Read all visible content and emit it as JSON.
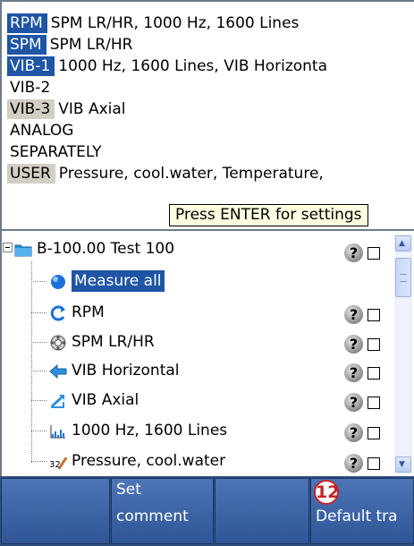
{
  "technologies": [
    {
      "tag": "RPM",
      "desc": "SPM LR/HR, 1000 Hz, 1600 Lines",
      "style": "sel"
    },
    {
      "tag": "SPM",
      "desc": "SPM LR/HR",
      "style": "sel"
    },
    {
      "tag": "VIB-1",
      "desc": "1000 Hz, 1600 Lines, VIB Horizonta",
      "style": "sel"
    },
    {
      "tag": "VIB-2",
      "desc": "",
      "style": "plain"
    },
    {
      "tag": "VIB-3",
      "desc": "VIB Axial",
      "style": "gray"
    },
    {
      "tag": "ANALOG",
      "desc": "",
      "style": "plain"
    },
    {
      "tag": "SEPARATELY",
      "desc": "",
      "style": "plain"
    },
    {
      "tag": "USER",
      "desc": "Pressure, cool.water, Temperature,",
      "style": "gray"
    }
  ],
  "tooltip": "Press ENTER for settings",
  "tree": {
    "root": {
      "label": "B-100.00 Test 100",
      "status": "?"
    },
    "children": [
      {
        "label": "Measure all",
        "icon": "measure-all-icon",
        "selected": true
      },
      {
        "label": "RPM",
        "icon": "rpm-icon",
        "status": "?"
      },
      {
        "label": "SPM LR/HR",
        "icon": "spm-icon",
        "status": "?"
      },
      {
        "label": "VIB Horizontal",
        "icon": "vib-horizontal-icon",
        "status": "?"
      },
      {
        "label": "VIB Axial",
        "icon": "vib-axial-icon",
        "status": "?"
      },
      {
        "label": "1000 Hz, 1600 Lines",
        "icon": "spectrum-icon",
        "status": "?"
      },
      {
        "label": "Pressure, cool.water",
        "icon": "pressure-icon",
        "status": "?",
        "icon_text": "32"
      }
    ]
  },
  "function_bar": {
    "buttons": [
      {
        "line1": "",
        "line2": ""
      },
      {
        "line1": "Set",
        "line2": "comment"
      },
      {
        "line1": "",
        "line2": ""
      },
      {
        "line1": "",
        "line2": "Default tra"
      }
    ],
    "badge": "12"
  },
  "colors": {
    "selection": "#1f55a5",
    "tag_gray": "#d3cec4",
    "function_bar": "#2f5596",
    "badge_red": "#c0252a",
    "tooltip_bg": "#ffffe1"
  }
}
